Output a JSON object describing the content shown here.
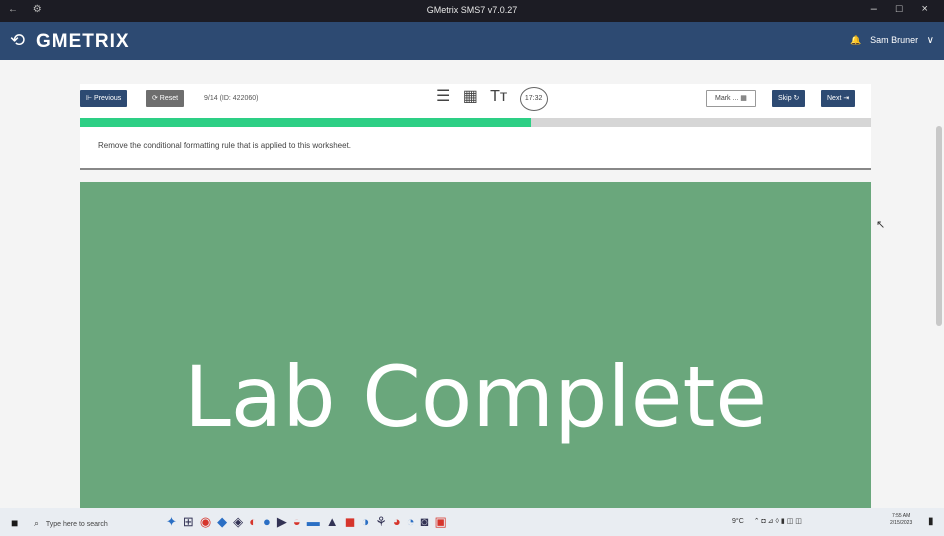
{
  "window": {
    "title": "GMetrix SMS7 v7.0.27",
    "left_icons": "← ⚙",
    "controls": "– □ ×"
  },
  "header": {
    "logout_icon": "⟲",
    "logo": "GMETRIX",
    "user": "Sam Bruner",
    "bell": "🔔",
    "chevron": "∨"
  },
  "toolbar": {
    "previous_label": "⊩ Previous",
    "reset_label": "⟳ Reset",
    "question_info": "9/14 (ID: 422060)",
    "list_icon": "☰",
    "calc_icon": "▦",
    "font_icon": "Tт",
    "timer": "17:32",
    "mark_label": "Mark ... ▦",
    "skip_label": "Skip ↻",
    "next_label": "Next ⇥"
  },
  "progress": {
    "value": 0.57,
    "color": "#2dcf85"
  },
  "question": {
    "text": "Remove the conditional formatting rule that is applied to this worksheet."
  },
  "lab": {
    "status_text": "Lab Complete"
  },
  "taskbar": {
    "windows_icon": "■",
    "search_placeholder": "Type here to search",
    "search_icon": "⌕",
    "apps": [
      "✦",
      "⊞",
      "◉",
      "◆",
      "◈",
      "◐",
      "●",
      "▶",
      "◒",
      "▬",
      "▲",
      "◼",
      "◑",
      "⚘",
      "◕",
      "◔",
      "◙",
      "▣"
    ],
    "weather": "9°C",
    "tray_icons": "⌃ ◘ ⊿ ◊ ▮ ◫ ◫",
    "clock_time": "7:55 AM",
    "clock_date": "2/15/2023",
    "notification_icon": "▮"
  }
}
